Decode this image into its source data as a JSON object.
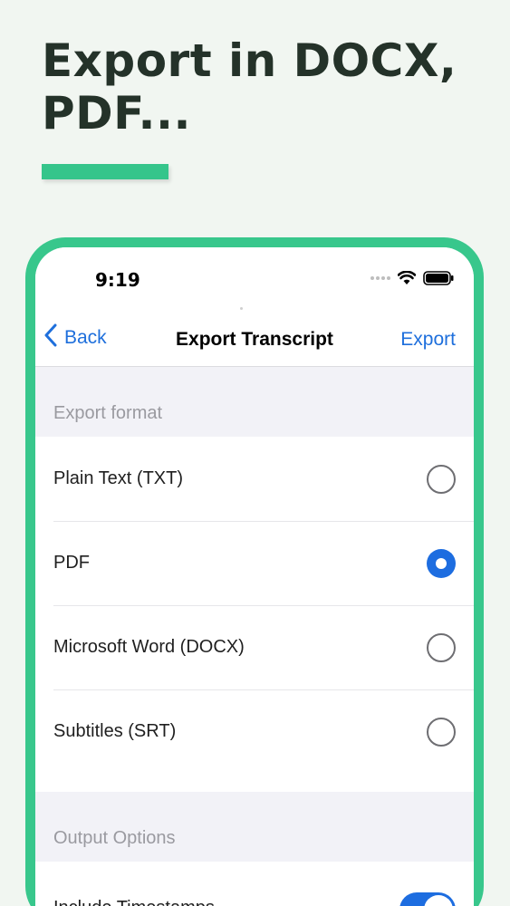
{
  "headline": "Export in DOCX, PDF...",
  "colors": {
    "accent_green": "#35c58b",
    "ios_blue": "#1d6de0"
  },
  "status_bar": {
    "time": "9:19",
    "icons": [
      "cellular-icon",
      "wifi-icon",
      "battery-icon"
    ]
  },
  "nav": {
    "back_label": "Back",
    "title": "Export Transcript",
    "action_label": "Export"
  },
  "export_format": {
    "header": "Export format",
    "options": [
      {
        "label": "Plain Text (TXT)",
        "selected": false
      },
      {
        "label": "PDF",
        "selected": true
      },
      {
        "label": "Microsoft Word (DOCX)",
        "selected": false
      },
      {
        "label": "Subtitles (SRT)",
        "selected": false
      }
    ]
  },
  "output_options": {
    "header": "Output Options",
    "items": [
      {
        "label": "Include Timestamps",
        "on": true
      }
    ]
  }
}
